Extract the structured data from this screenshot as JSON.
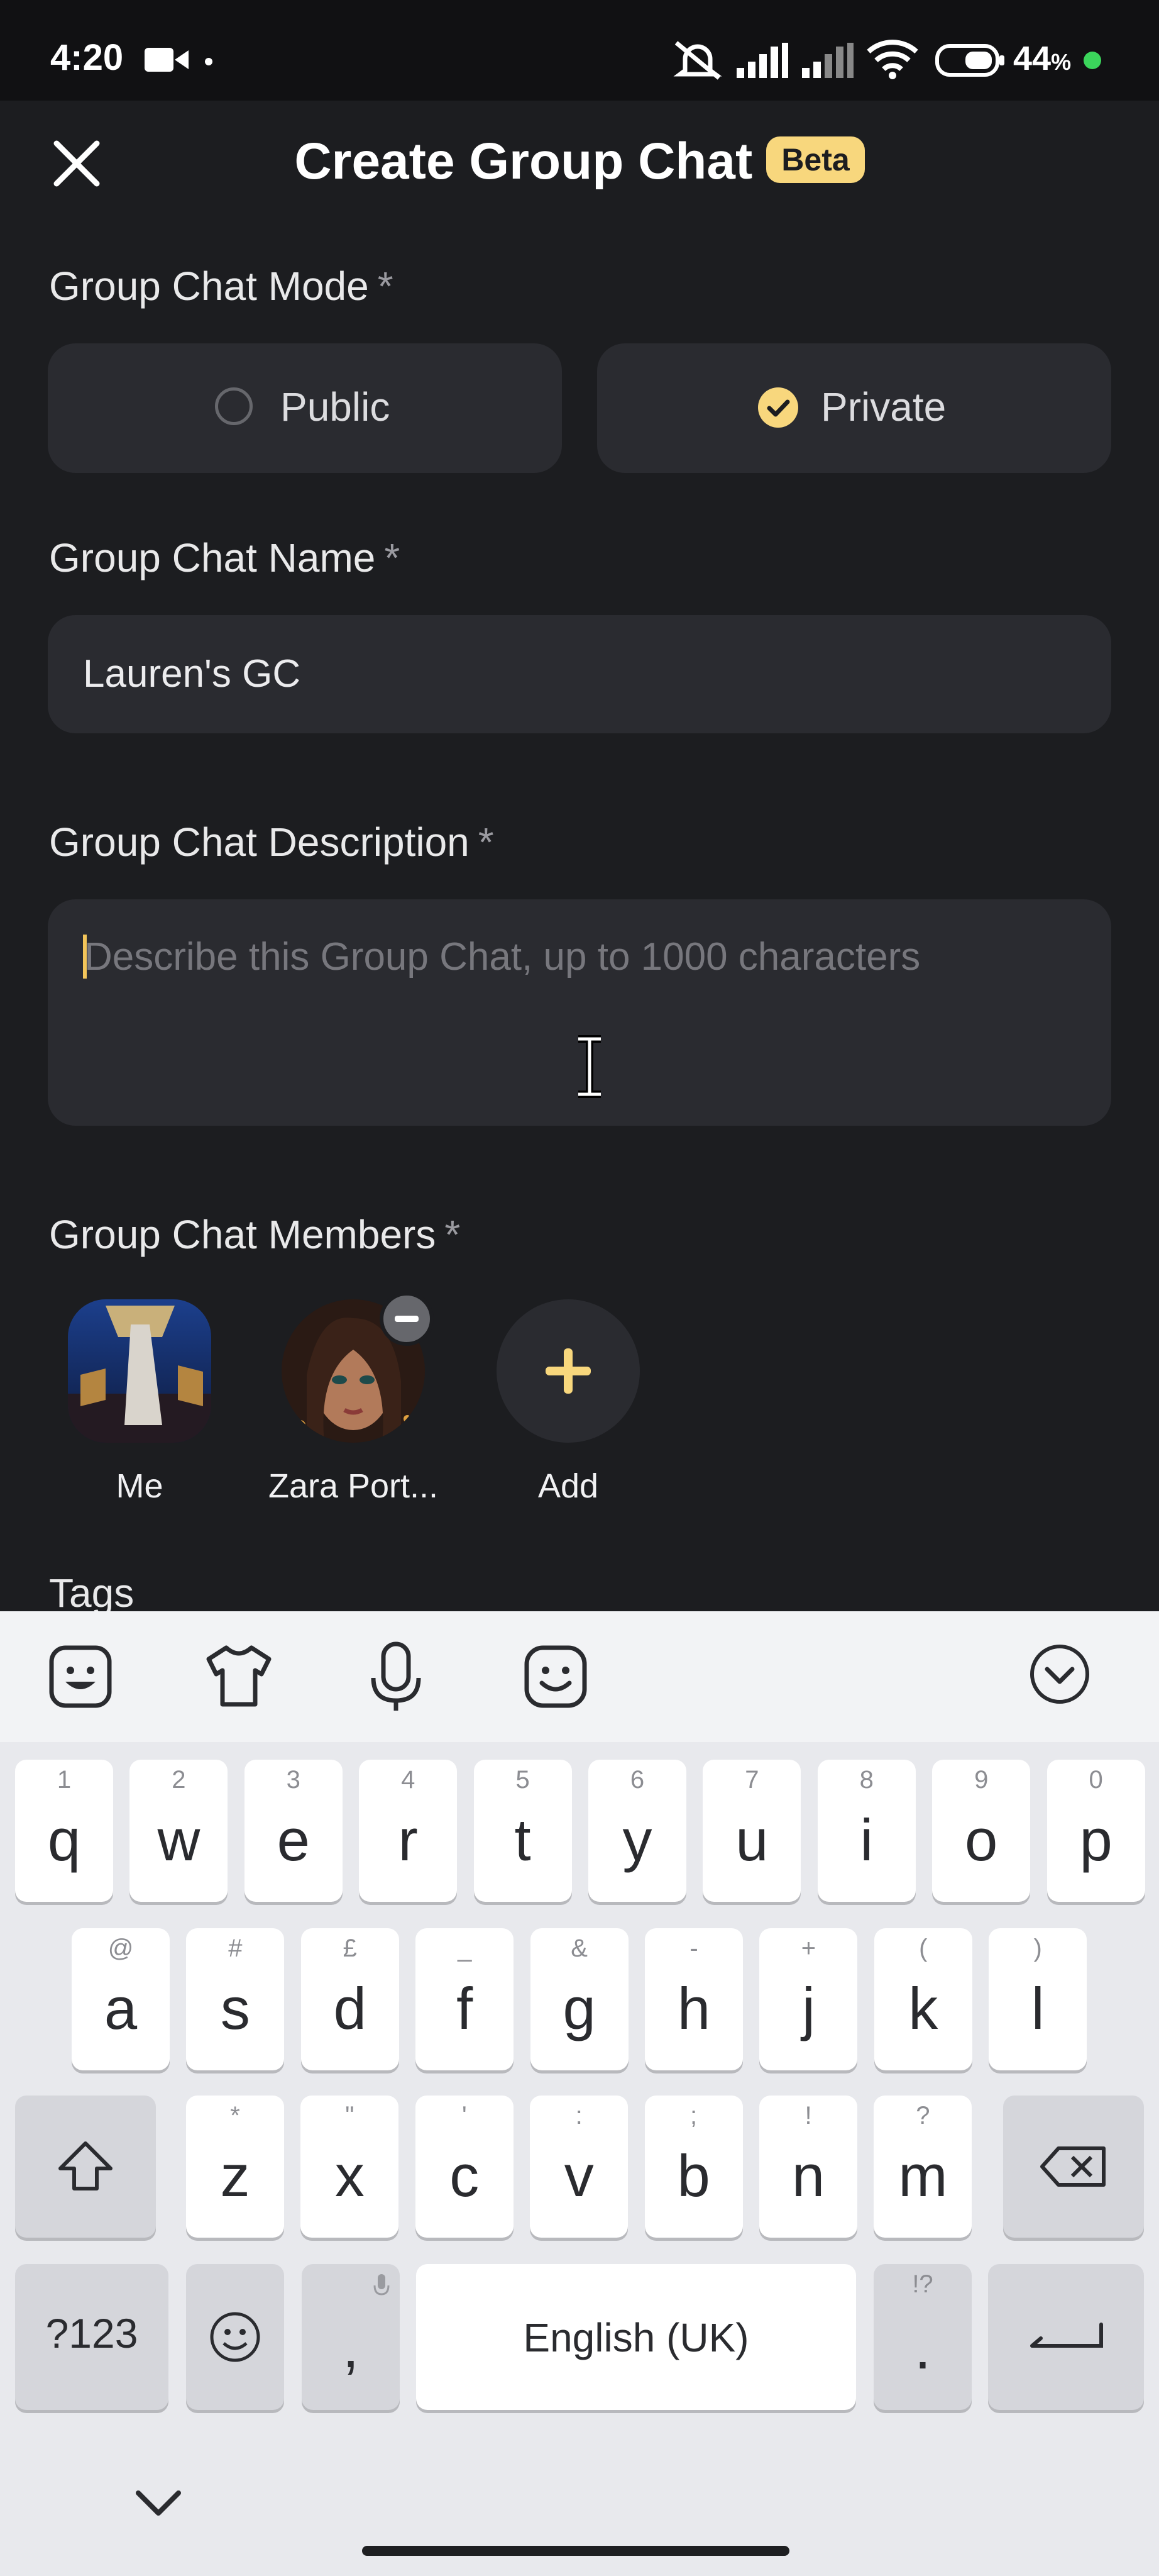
{
  "status_bar": {
    "time": "4:20",
    "battery": "44",
    "battery_unit": "%",
    "icons": [
      "video-camera-icon",
      "dot-icon",
      "mute-icon",
      "signal-icon",
      "signal-icon",
      "wifi-icon",
      "battery-icon",
      "green-dot-icon"
    ]
  },
  "header": {
    "title": "Create Group Chat",
    "badge": "Beta",
    "close_icon": "close-icon"
  },
  "mode": {
    "label": "Group Chat Mode",
    "required": "*",
    "options": [
      {
        "label": "Public",
        "selected": false
      },
      {
        "label": "Private",
        "selected": true
      }
    ]
  },
  "name": {
    "label": "Group Chat Name",
    "required": "*",
    "value": "Lauren's GC"
  },
  "description": {
    "label": "Group Chat Description",
    "required": "*",
    "placeholder": "Describe this Group Chat, up to 1000 characters"
  },
  "members": {
    "label": "Group Chat Members",
    "required": "*",
    "list": [
      {
        "name": "Me"
      },
      {
        "name": "Zara Port..."
      }
    ],
    "add_label": "Add"
  },
  "tags": {
    "label": "Tags"
  },
  "keyboard": {
    "toolbar": [
      "sticker-icon",
      "theme-shirt-icon",
      "microphone-icon",
      "emoji-icon",
      "collapse-icon"
    ],
    "row1": [
      {
        "k": "q",
        "h": "1"
      },
      {
        "k": "w",
        "h": "2"
      },
      {
        "k": "e",
        "h": "3"
      },
      {
        "k": "r",
        "h": "4"
      },
      {
        "k": "t",
        "h": "5"
      },
      {
        "k": "y",
        "h": "6"
      },
      {
        "k": "u",
        "h": "7"
      },
      {
        "k": "i",
        "h": "8"
      },
      {
        "k": "o",
        "h": "9"
      },
      {
        "k": "p",
        "h": "0"
      }
    ],
    "row2": [
      {
        "k": "a",
        "h": "@"
      },
      {
        "k": "s",
        "h": "#"
      },
      {
        "k": "d",
        "h": "£"
      },
      {
        "k": "f",
        "h": "_"
      },
      {
        "k": "g",
        "h": "&"
      },
      {
        "k": "h",
        "h": "-"
      },
      {
        "k": "j",
        "h": "+"
      },
      {
        "k": "k",
        "h": "("
      },
      {
        "k": "l",
        "h": ")"
      }
    ],
    "row3": [
      {
        "k": "z",
        "h": "*"
      },
      {
        "k": "x",
        "h": "\""
      },
      {
        "k": "c",
        "h": "'"
      },
      {
        "k": "v",
        "h": ":"
      },
      {
        "k": "b",
        "h": ";"
      },
      {
        "k": "n",
        "h": "!"
      },
      {
        "k": "m",
        "h": "?"
      }
    ],
    "symbols_key": "?123",
    "comma": ",",
    "space": "English (UK)",
    "period": ".",
    "period_hint": "!?"
  }
}
